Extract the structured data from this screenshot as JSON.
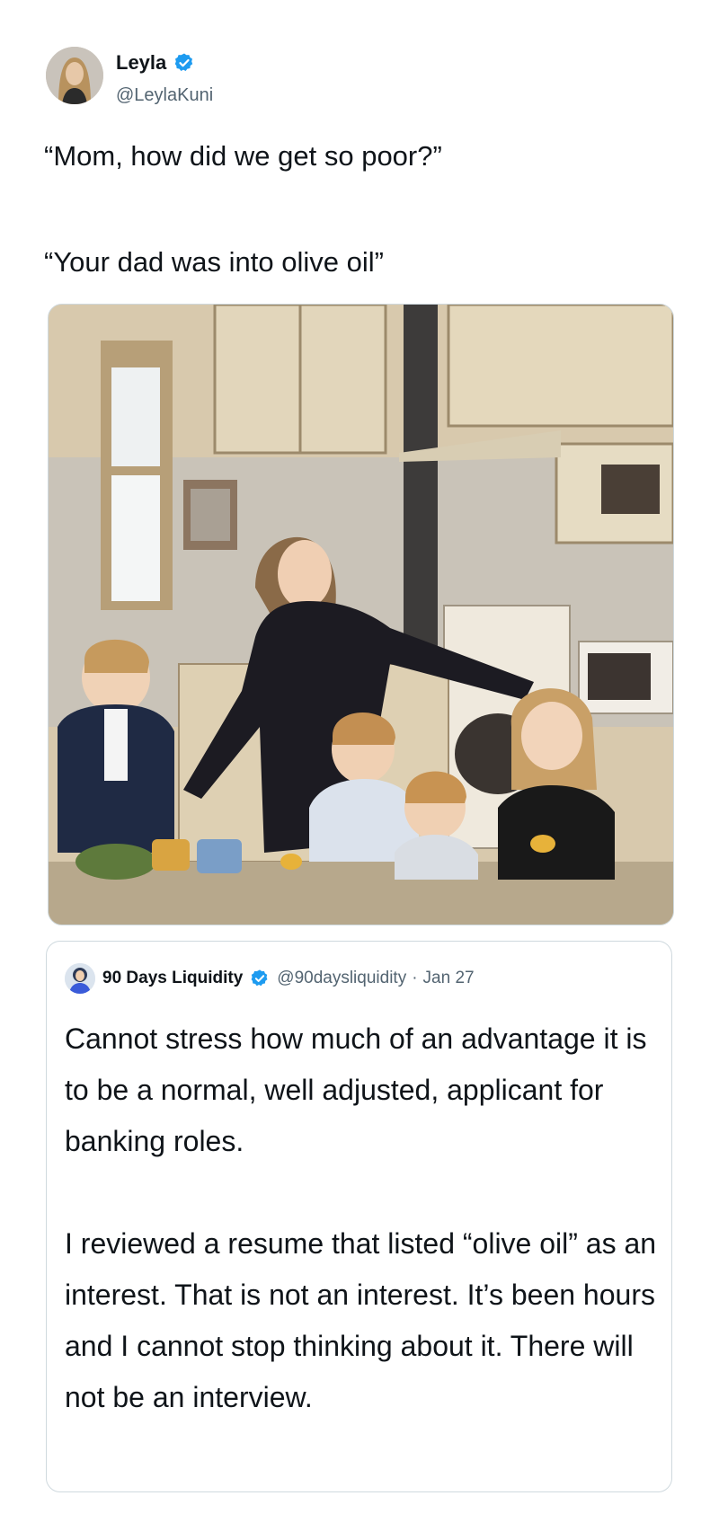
{
  "author": {
    "name": "Leyla",
    "handle": "@LeylaKuni",
    "verified_icon": "verified-badge-icon",
    "verified_color": "#1d9bf0"
  },
  "tweet": {
    "line1": "“Mom, how did we get so poor?”",
    "line2": "“Your dad was into olive oil”"
  },
  "media": {
    "alt_subject": "kitchen-family-photo"
  },
  "quote": {
    "name": "90 Days Liquidity",
    "handle": "@90daysliquidity",
    "separator": "·",
    "date": "Jan 27",
    "paragraph1": "Cannot stress how much of an advantage it is to be a normal, well adjusted, applicant for banking roles.",
    "paragraph2": "I reviewed a resume that listed “olive oil” as an interest. That is not an interest. It’s been hours and I cannot stop thinking about it. There will not be an interview."
  },
  "colors": {
    "text": "#0f1419",
    "secondary": "#536471",
    "border": "#cfd9de"
  }
}
